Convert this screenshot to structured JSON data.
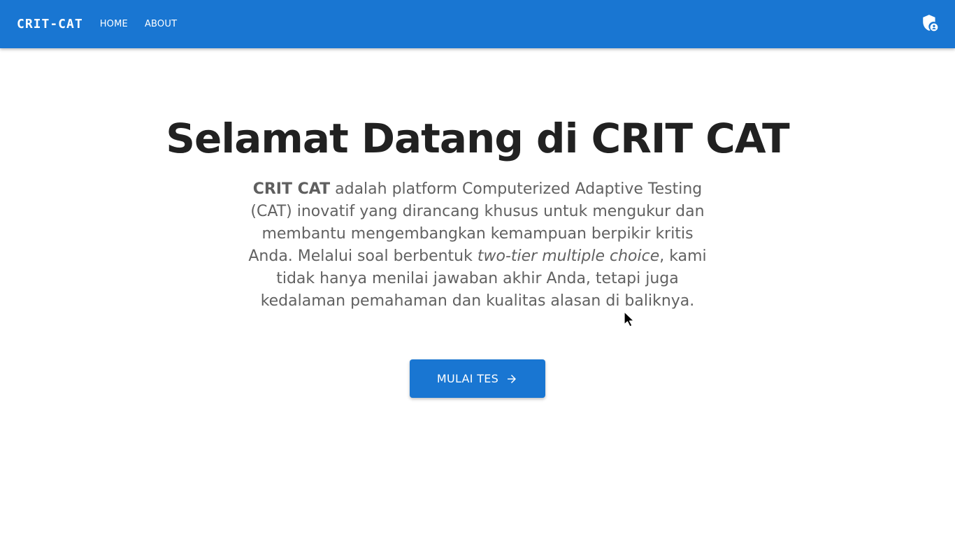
{
  "header": {
    "brand": "CRIT-CAT",
    "nav": [
      {
        "label": "HOME"
      },
      {
        "label": "ABOUT"
      }
    ],
    "admin_icon": "shield-account-icon"
  },
  "hero": {
    "title": "Selamat Datang di CRIT CAT",
    "description": {
      "brand_bold": "CRIT CAT",
      "part1": " adalah platform Computerized Adaptive Testing (CAT) inovatif yang dirancang khusus untuk mengukur dan membantu mengembangkan kemampuan berpikir kritis Anda. Melalui soal berbentuk ",
      "italic": "two-tier multiple choice",
      "part2": ", kami tidak hanya menilai jawaban akhir Anda, tetapi juga kedalaman pemahaman dan kualitas alasan di baliknya."
    },
    "cta_label": "MULAI TES",
    "cta_icon": "arrow-right-icon"
  },
  "colors": {
    "primary": "#1976d2",
    "title": "#212121",
    "body_text": "#616161",
    "background": "#ffffff"
  }
}
